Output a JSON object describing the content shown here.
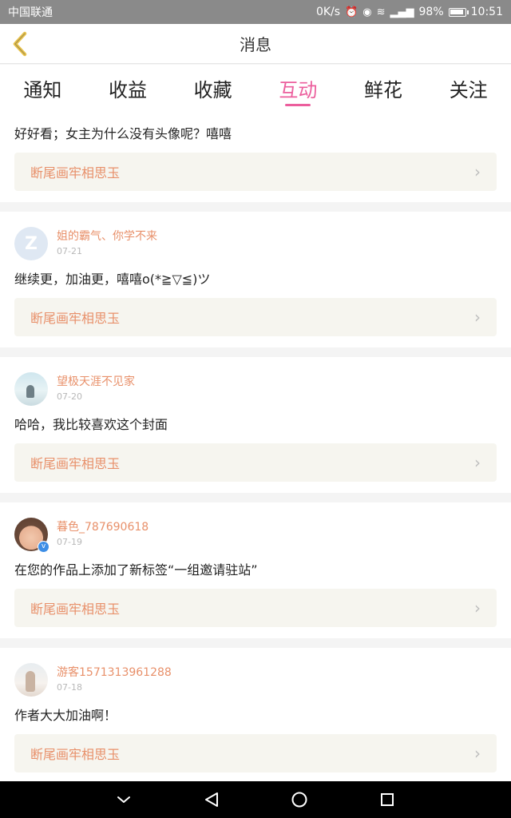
{
  "statusbar": {
    "carrier": "中国联通",
    "speed": "0K/s",
    "battery": "98%",
    "time": "10:51"
  },
  "header": {
    "title": "消息",
    "back_icon": "chevron-left-icon"
  },
  "tabs": [
    {
      "label": "通知",
      "active": false
    },
    {
      "label": "收益",
      "active": false
    },
    {
      "label": "收藏",
      "active": false
    },
    {
      "label": "互动",
      "active": true
    },
    {
      "label": "鲜花",
      "active": false
    },
    {
      "label": "关注",
      "active": false
    }
  ],
  "accent_color": "#ec5e9d",
  "name_color": "#e8906a",
  "feed": [
    {
      "partial": true,
      "message": "好好看；女主为什么没有头像呢？嘻嘻",
      "work": "断尾画牢相思玉"
    },
    {
      "avatar": "default-avatar-icon",
      "avatar_letter": "Z",
      "username": "姐的霸气、你学不来",
      "date": "07-21",
      "message": "继续更，加油更，嘻嘻o(*≧▽≦)ツ",
      "work": "断尾画牢相思玉"
    },
    {
      "avatar": "scenic-avatar",
      "username": "望极天涯不见家",
      "date": "07-20",
      "message": "哈哈，我比较喜欢这个封面",
      "work": "断尾画牢相思玉"
    },
    {
      "avatar": "child-avatar",
      "verified": true,
      "verified_mark": "v",
      "username": "暮色_787690618",
      "date": "07-19",
      "message": "在您的作品上添加了新标签“一组邀请驻站”",
      "work": "断尾画牢相思玉"
    },
    {
      "avatar": "girl-avatar",
      "username": "游客1571313961288",
      "date": "07-18",
      "message": "作者大大加油啊！",
      "work": "断尾画牢相思玉"
    }
  ],
  "chevron_glyph": "›"
}
